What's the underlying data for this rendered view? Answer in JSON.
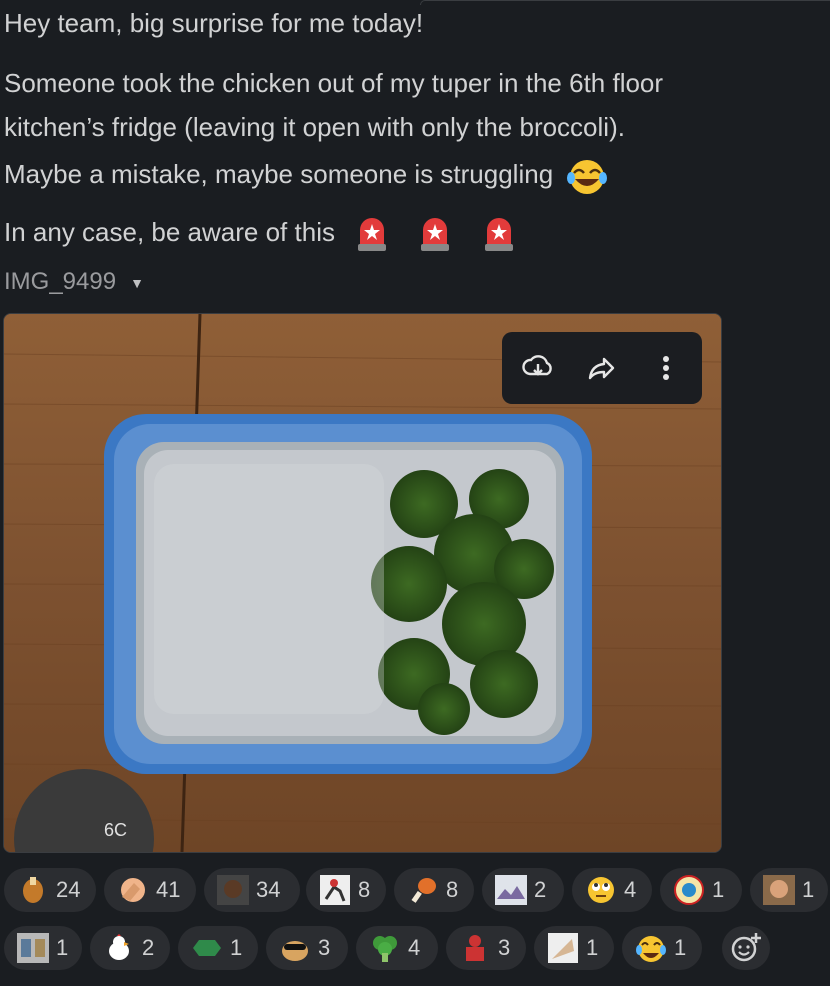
{
  "message": {
    "line1": "Hey team, big surprise for me today!",
    "line2": "Someone took the chicken out of my tuper in the 6th floor",
    "line3": "kitchen’s fridge (leaving it open with only the broccoli).",
    "line4": "Maybe a mistake, maybe someone is struggling",
    "line5": "In any case, be aware of this",
    "emoji_line4": "joy",
    "emoji_line5": [
      "rotating-light",
      "rotating-light",
      "rotating-light"
    ]
  },
  "attachment": {
    "filename": "IMG_9499",
    "overlay_text": "6C",
    "toolbar": [
      "download-icon",
      "share-icon",
      "more-icon"
    ]
  },
  "reactions": {
    "row1": [
      {
        "icon": "chicken-leg-icon",
        "count": "24"
      },
      {
        "icon": "facepalm-icon",
        "count": "41"
      },
      {
        "icon": "face-photo-icon",
        "count": "34"
      },
      {
        "icon": "running-chef-icon",
        "count": "8"
      },
      {
        "icon": "drumstick-icon",
        "count": "8"
      },
      {
        "icon": "scene-icon",
        "count": "2"
      },
      {
        "icon": "eye-roll-icon",
        "count": "4"
      },
      {
        "icon": "los-pollos-icon",
        "count": "1"
      },
      {
        "icon": "man-photo-icon",
        "count": "1"
      }
    ],
    "row2": [
      {
        "icon": "meme-icon",
        "count": "1"
      },
      {
        "icon": "chicken-icon",
        "count": "2"
      },
      {
        "icon": "sign-icon",
        "count": "1"
      },
      {
        "icon": "cool-dog-icon",
        "count": "3"
      },
      {
        "icon": "broccoli-icon",
        "count": "4"
      },
      {
        "icon": "chef-icon",
        "count": "3"
      },
      {
        "icon": "hand-icon",
        "count": "1"
      },
      {
        "icon": "joy-icon",
        "count": "1"
      }
    ]
  }
}
